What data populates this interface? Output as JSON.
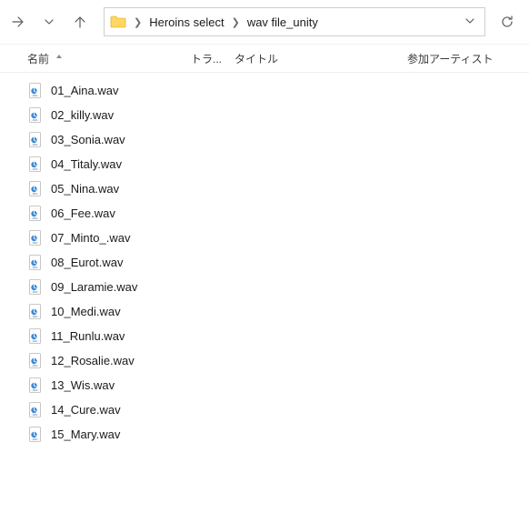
{
  "breadcrumb": {
    "items": [
      {
        "label": "Heroins select"
      },
      {
        "label": "wav file_unity"
      }
    ]
  },
  "columns": {
    "name": "名前",
    "track": "トラ...",
    "title": "タイトル",
    "artist": "参加アーティスト"
  },
  "files": [
    {
      "name": "01_Aina.wav"
    },
    {
      "name": "02_killy.wav"
    },
    {
      "name": "03_Sonia.wav"
    },
    {
      "name": "04_Titaly.wav"
    },
    {
      "name": "05_Nina.wav"
    },
    {
      "name": "06_Fee.wav"
    },
    {
      "name": "07_Minto_.wav"
    },
    {
      "name": "08_Eurot.wav"
    },
    {
      "name": "09_Laramie.wav"
    },
    {
      "name": "10_Medi.wav"
    },
    {
      "name": "11_Runlu.wav"
    },
    {
      "name": "12_Rosalie.wav"
    },
    {
      "name": "13_Wis.wav"
    },
    {
      "name": "14_Cure.wav"
    },
    {
      "name": "15_Mary.wav"
    }
  ]
}
